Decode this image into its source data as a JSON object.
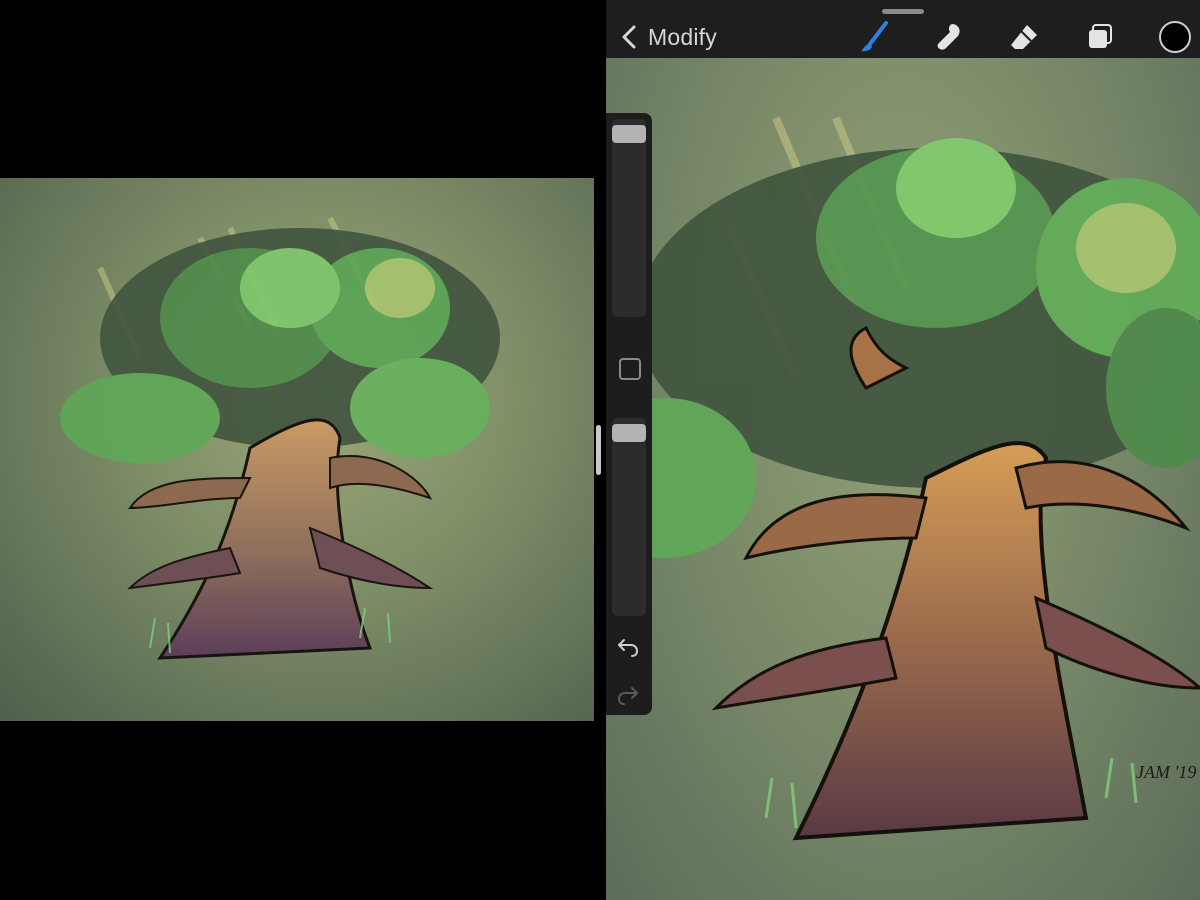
{
  "header": {
    "back_label": "Modify",
    "tools": [
      "brush-icon",
      "smudge-icon",
      "eraser-icon",
      "layers-icon"
    ],
    "active_tool": "brush-icon",
    "active_color": "#000000",
    "accent_color": "#2f7fe6"
  },
  "sidebar": {
    "brush_size_level": 0.02,
    "opacity_level": 0.02,
    "undo_icon": "undo-icon",
    "redo_icon": "redo-icon"
  },
  "artwork": {
    "signature": "JAM '19"
  }
}
